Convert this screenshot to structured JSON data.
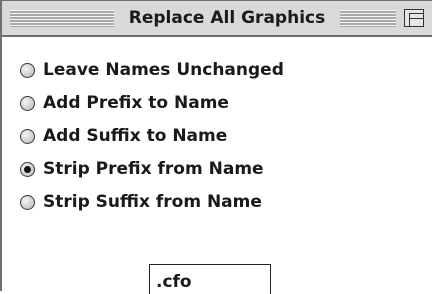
{
  "window": {
    "title": "Replace All Graphics"
  },
  "options": [
    {
      "label": "Leave Names Unchanged",
      "checked": false
    },
    {
      "label": "Add Prefix to Name",
      "checked": false
    },
    {
      "label": "Add Suffix to Name",
      "checked": false
    },
    {
      "label": "Strip Prefix from Name",
      "checked": true
    },
    {
      "label": "Strip Suffix from Name",
      "checked": false
    }
  ],
  "name_field": {
    "value": ".cfo"
  }
}
